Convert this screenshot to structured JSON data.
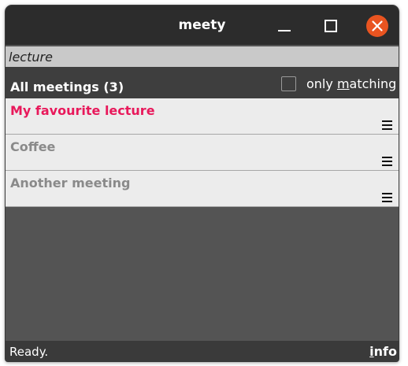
{
  "window": {
    "title": "meety"
  },
  "search": {
    "value": "lecture"
  },
  "header": {
    "all_meetings_label": "All meetings (3)",
    "only_matching_prefix": "only ",
    "only_matching_mnemonic": "m",
    "only_matching_suffix": "atching",
    "only_matching_checked": false
  },
  "meetings": [
    {
      "title": "My favourite lecture",
      "matched": true,
      "color": "#e8195b",
      "menu_icon": "hamburger-menu-icon"
    },
    {
      "title": "Coffee",
      "matched": false,
      "color": "#8a8a8a",
      "menu_icon": "hamburger-menu-icon"
    },
    {
      "title": "Another meeting",
      "matched": false,
      "color": "#8a8a8a",
      "menu_icon": "hamburger-menu-icon"
    }
  ],
  "status": {
    "text": "Ready.",
    "info_mnemonic": "i",
    "info_rest": "nfo"
  },
  "colors": {
    "accent_close": "#e95420",
    "match_highlight": "#e8195b",
    "nonmatch_text": "#8a8a8a",
    "titlebar": "#2c2c2c",
    "body": "#545454"
  }
}
